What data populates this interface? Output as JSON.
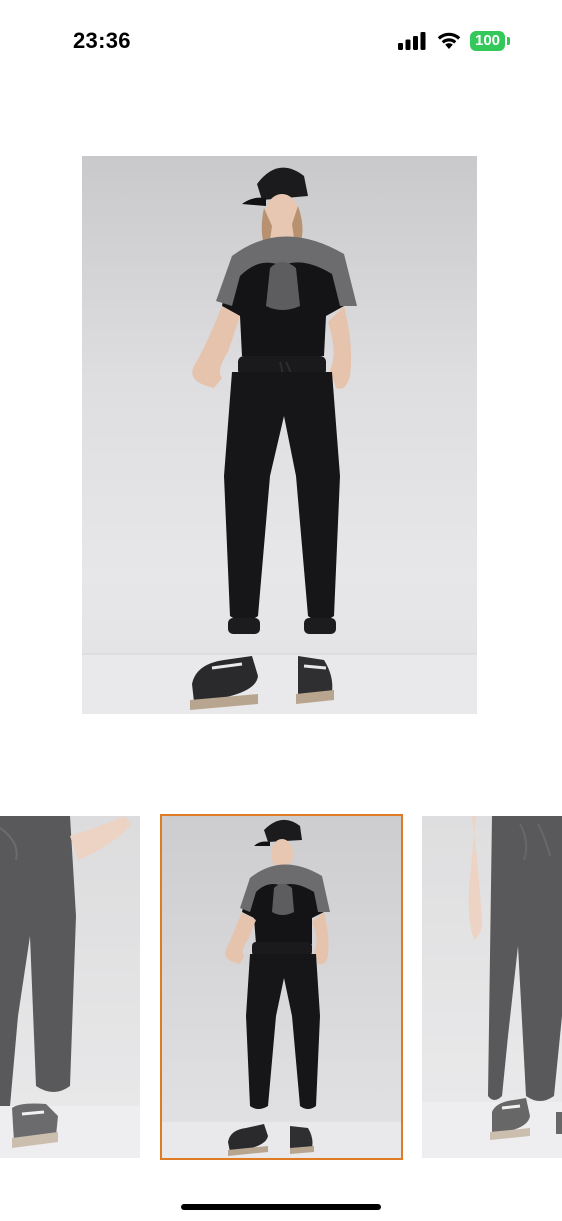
{
  "status_bar": {
    "time": "23:36",
    "battery_level": "100",
    "battery_color": "#34c759",
    "icons": [
      "signal-icon",
      "wifi-icon",
      "battery-icon"
    ]
  },
  "gallery": {
    "main_image": "product-photo-main",
    "thumbnails": [
      {
        "name": "thumbnail-trousers-closeup-left",
        "selected": false
      },
      {
        "name": "thumbnail-full-outfit",
        "selected": true
      },
      {
        "name": "thumbnail-trousers-closeup-right",
        "selected": false
      }
    ],
    "selected_border_color": "#e07b25"
  }
}
